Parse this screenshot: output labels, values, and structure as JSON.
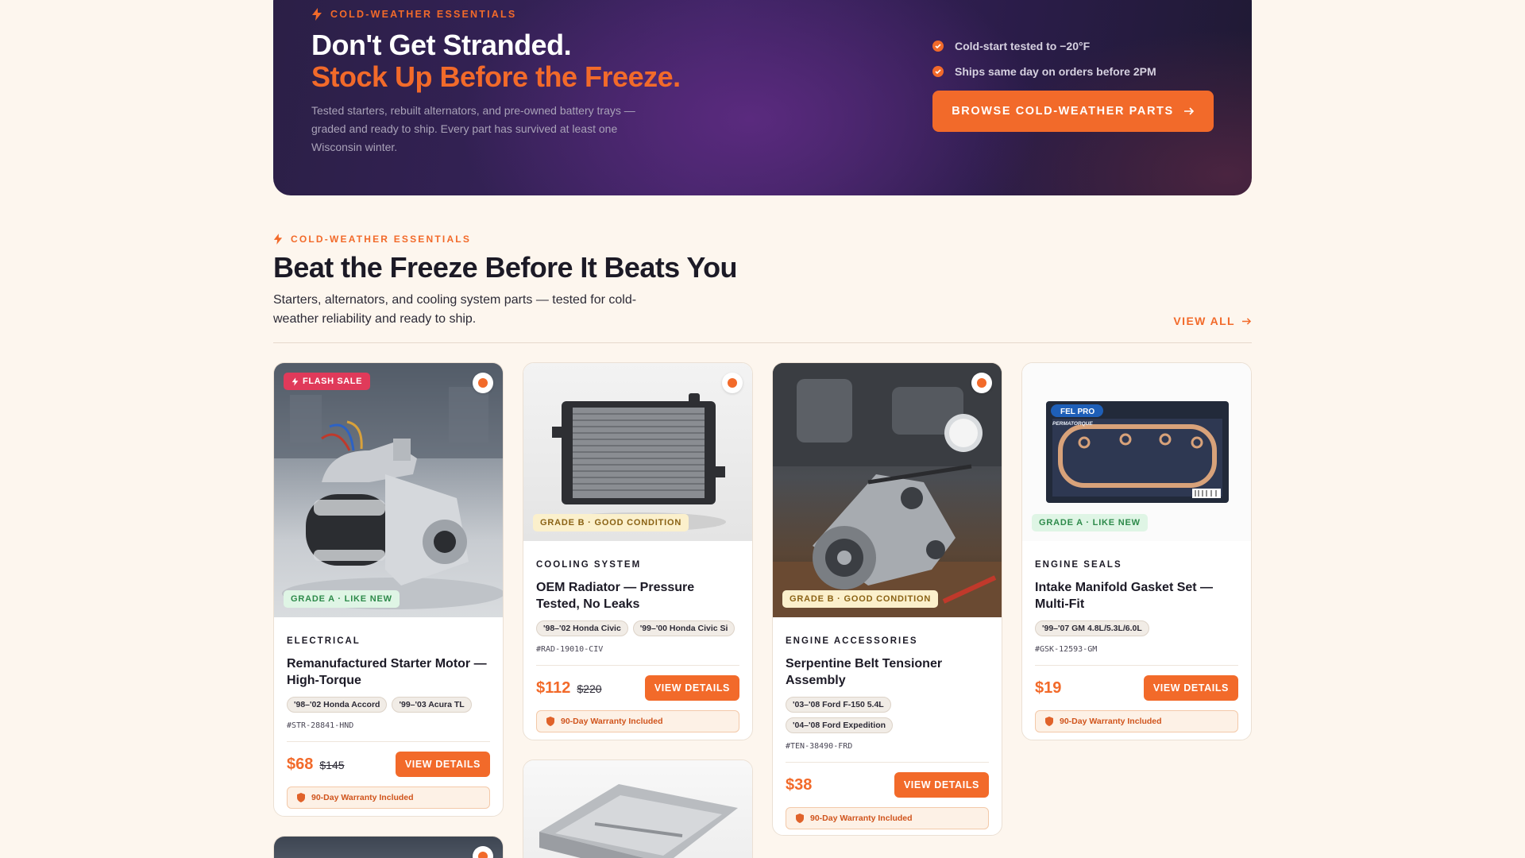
{
  "hero": {
    "eyebrow": "COLD-WEATHER ESSENTIALS",
    "title_line1": "Don't Get Stranded.",
    "title_line2": "Stock Up Before the Freeze.",
    "description": "Tested starters, rebuilt alternators, and pre-owned battery trays — graded and ready to ship. Every part has survived at least one Wisconsin winter.",
    "checks": [
      "Cold-start tested to −20°F",
      "Ships same day on orders before 2PM"
    ],
    "cta_label": "BROWSE COLD-WEATHER PARTS"
  },
  "section": {
    "eyebrow": "COLD-WEATHER ESSENTIALS",
    "title": "Beat the Freeze Before It Beats You",
    "description": "Starters, alternators, and cooling system parts — tested for cold-weather reliability and ready to ship.",
    "view_all": "VIEW ALL"
  },
  "products": [
    {
      "sale_badge": "FLASH SALE",
      "grade": "GRADE A · LIKE NEW",
      "category": "ELECTRICAL",
      "title": "Remanufactured Starter Motor — High-Torque",
      "fitments": [
        "'98–'02 Honda Accord",
        "'99–'03 Acura TL"
      ],
      "sku": "#STR-28841-HND",
      "price": "$68",
      "was_price": "$145",
      "button": "VIEW DETAILS",
      "warranty": "90-Day Warranty Included"
    },
    {
      "grade": "GRADE B · GOOD CONDITION",
      "category": "COOLING SYSTEM",
      "title": "OEM Radiator — Pressure Tested, No Leaks",
      "fitments": [
        "'98–'02 Honda Civic",
        "'99–'00 Honda Civic Si"
      ],
      "sku": "#RAD-19010-CIV",
      "price": "$112",
      "was_price": "$220",
      "button": "VIEW DETAILS",
      "warranty": "90-Day Warranty Included"
    },
    {
      "grade": "GRADE B · GOOD CONDITION",
      "category": "ENGINE ACCESSORIES",
      "title": "Serpentine Belt Tensioner Assembly",
      "fitments": [
        "'03–'08 Ford F-150 5.4L",
        "'04–'08 Ford Expedition"
      ],
      "sku": "#TEN-38490-FRD",
      "price": "$38",
      "button": "VIEW DETAILS",
      "warranty": "90-Day Warranty Included"
    },
    {
      "grade": "GRADE A · LIKE NEW",
      "category": "ENGINE SEALS",
      "title": "Intake Manifold Gasket Set — Multi-Fit",
      "fitments": [
        "'99–'07 GM 4.8L/5.3L/6.0L"
      ],
      "sku": "#GSK-12593-GM",
      "price": "$19",
      "button": "VIEW DETAILS",
      "warranty": "90-Day Warranty Included",
      "package_brand": "FEL PRO",
      "package_subbrand": "PERMATORQUE"
    }
  ],
  "colors": {
    "accent": "#f26a2a",
    "sale": "#e03a5a",
    "page_bg": "#fdf6ee"
  }
}
